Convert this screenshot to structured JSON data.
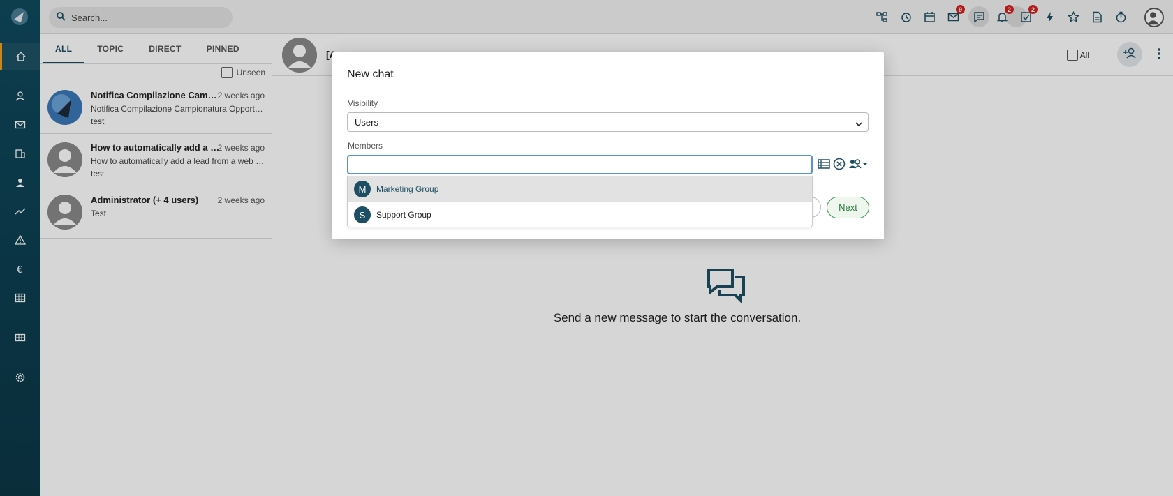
{
  "topbar": {
    "search_placeholder": "Search...",
    "icons": [
      {
        "name": "org-chart-icon",
        "badge": ""
      },
      {
        "name": "history-icon",
        "badge": ""
      },
      {
        "name": "calendar-icon",
        "badge": ""
      },
      {
        "name": "mail-icon",
        "badge": "9"
      },
      {
        "name": "chat-icon",
        "badge": ""
      },
      {
        "name": "bell-icon",
        "badge": "2"
      },
      {
        "name": "tasks-icon",
        "badge": "2"
      },
      {
        "name": "lightning-icon",
        "badge": ""
      },
      {
        "name": "star-icon",
        "badge": ""
      },
      {
        "name": "document-icon",
        "badge": ""
      },
      {
        "name": "timer-icon",
        "badge": ""
      }
    ]
  },
  "list": {
    "tabs": [
      "ALL",
      "TOPIC",
      "DIRECT",
      "PINNED"
    ],
    "active_tab": "ALL",
    "unseen_label": "Unseen",
    "conversations": [
      {
        "title": "Notifica Compilazione Campionatura Opportunità",
        "time": "2 weeks ago",
        "subtitle": "Notifica Compilazione Campionatura Opportunità",
        "preview": "test"
      },
      {
        "title": "How to automatically add a lead from a web form",
        "time": "2 weeks ago",
        "subtitle": "How to automatically add a lead from a web form",
        "preview": "test"
      },
      {
        "title": "Administrator (+ 4 users)",
        "time": "2 weeks ago",
        "subtitle": "Test",
        "preview": ""
      }
    ]
  },
  "chat": {
    "header_title": "[A",
    "all_label": "All",
    "empty_message": "Send a new message to start the conversation."
  },
  "modal": {
    "title": "New chat",
    "visibility_label": "Visibility",
    "visibility_value": "Users",
    "members_label": "Members",
    "members_value": "",
    "suggestions": [
      {
        "letter": "M",
        "name": "Marketing Group"
      },
      {
        "letter": "S",
        "name": "Support Group"
      }
    ],
    "next_label": "Next"
  },
  "colors": {
    "rail": "#0f4a5e",
    "accent": "#1d4e63",
    "badge": "#d62020",
    "next_border": "#3a9a4a",
    "active_nav": "#f0a020"
  }
}
